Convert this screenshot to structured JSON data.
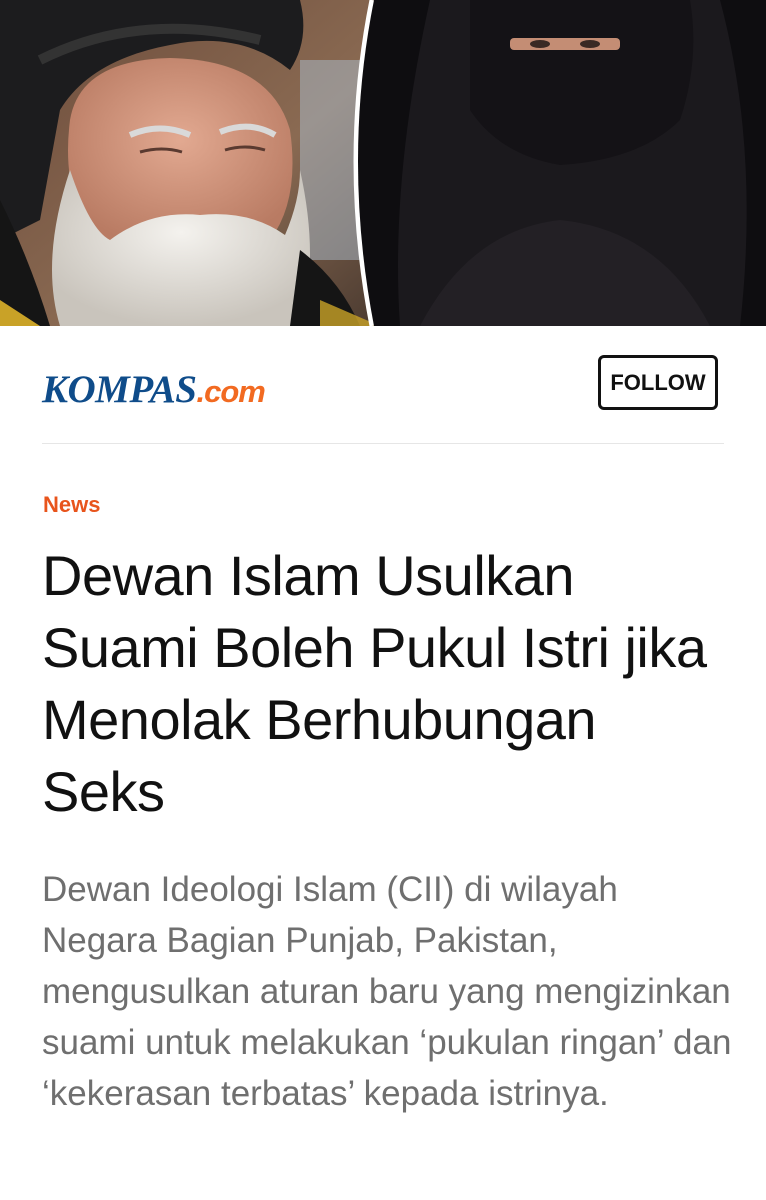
{
  "article": {
    "hero_image_alt": "Photo of an elderly bearded man in a black turban beside a woman wearing a black niqab",
    "publisher": {
      "logo_main": "KOMPAS",
      "logo_suffix": ".com",
      "follow_label": "FOLLOW"
    },
    "category": "News",
    "headline": "Dewan Islam Usulkan Suami Boleh Pukul Istri jika Menolak Berhubungan Seks",
    "summary": "Dewan Ideologi Islam (CII) di wilayah Negara Bagian Punjab, Pakistan, mengusulkan aturan baru yang mengizinkan suami untuk melakukan ‘pukulan ringan’ dan ‘kekerasan terbatas’ kepada istrinya."
  },
  "colors": {
    "logo_blue": "#0f4c8a",
    "logo_orange": "#f26a21",
    "category_orange": "#e8541c",
    "headline": "#111111",
    "summary": "#6f6f6f"
  }
}
